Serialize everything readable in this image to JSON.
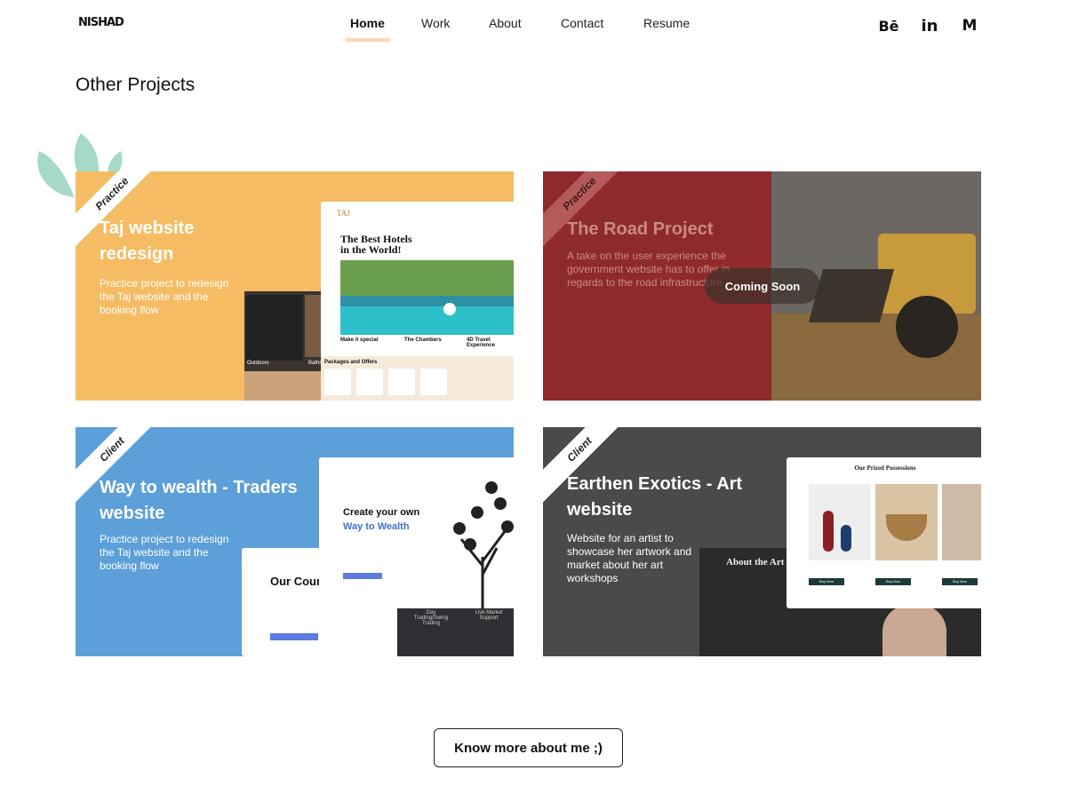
{
  "header": {
    "logo": "NISHAD",
    "nav": [
      {
        "label": "Home",
        "active": true
      },
      {
        "label": "Work",
        "active": false
      },
      {
        "label": "About",
        "active": false
      },
      {
        "label": "Contact",
        "active": false
      },
      {
        "label": "Resume",
        "active": false
      }
    ],
    "social": [
      {
        "icon": "behance-icon",
        "glyph": "Bē"
      },
      {
        "icon": "linkedin-icon",
        "glyph": "in"
      },
      {
        "icon": "medium-icon",
        "glyph": "M"
      }
    ]
  },
  "section_title": "Other Projects",
  "projects": [
    {
      "tag": "Practice",
      "title_lines": [
        "Taj website",
        "redesign"
      ],
      "description_lines": [
        "Practice project to redesign",
        "the Taj website and the",
        "booking flow"
      ],
      "color": "#f5bc63",
      "mock": {
        "logo": "TAJ",
        "headline_lines": [
          "The Best Hotels",
          "in the World!"
        ],
        "col1": "Make it special",
        "col2": "The Chambers",
        "col3": "4D Travel Experience",
        "packages": "Packages and Offers",
        "labels": [
          "Outdoors",
          "Bathroom"
        ]
      }
    },
    {
      "tag": "Practice",
      "title_lines": [
        "The Road Project"
      ],
      "description_lines": [
        "A take on the user experience the",
        "government website has to offer in",
        "regards to the road infrastructure"
      ],
      "color": "#8f2a2a",
      "badge": "Coming Soon"
    },
    {
      "tag": "Client",
      "title_lines": [
        "Way to wealth - Traders",
        "website"
      ],
      "description_lines": [
        "Practice project to redesign",
        "the Taj website and the",
        "booking flow"
      ],
      "color": "#5c9fd9",
      "mock": {
        "headline": "Create your own",
        "headline_accent": "Way to Wealth",
        "courses": "Our Cours",
        "side1": "Day Trading/Swing Trading",
        "side2": "Live Market Support"
      }
    },
    {
      "tag": "Client",
      "title_lines": [
        "Earthen Exotics - Art",
        "website"
      ],
      "description_lines": [
        "Website for an artist to",
        "showcase her artwork and",
        "market about her art",
        "workshops"
      ],
      "color": "#4a4a4a",
      "mock": {
        "heading": "Our Prized Possessions",
        "about": "About the Art",
        "buy": "Buy Now"
      }
    }
  ],
  "cta": "Know more about me ;)"
}
